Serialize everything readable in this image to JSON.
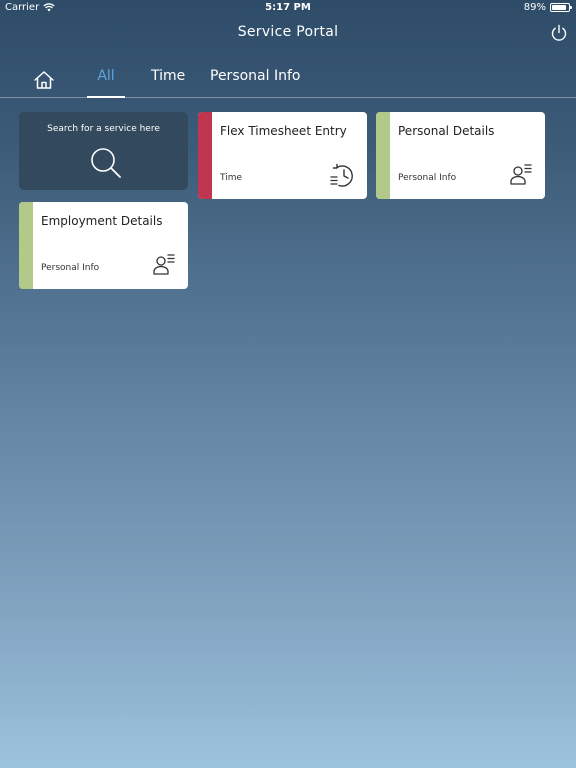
{
  "status_bar": {
    "carrier": "Carrier",
    "time": "5:17 PM",
    "battery": "89%",
    "battery_level": 0.89
  },
  "header": {
    "title": "Service Portal"
  },
  "tabs": {
    "all": "All",
    "time": "Time",
    "personal": "Personal Info",
    "active": "All"
  },
  "search": {
    "label": "Search for a service here"
  },
  "cards": [
    {
      "title": "Flex Timesheet Entry",
      "category": "Time",
      "stripe_color": "#c0354f",
      "icon": "timesheet-icon"
    },
    {
      "title": "Personal Details",
      "category": "Personal Info",
      "stripe_color": "#b3c98a",
      "icon": "person-list-icon"
    },
    {
      "title": "Employment Details",
      "category": "Personal Info",
      "stripe_color": "#b3c98a",
      "icon": "person-list-icon"
    }
  ],
  "colors": {
    "active_tab": "#5aa6e0",
    "search_card": "#33495d"
  }
}
